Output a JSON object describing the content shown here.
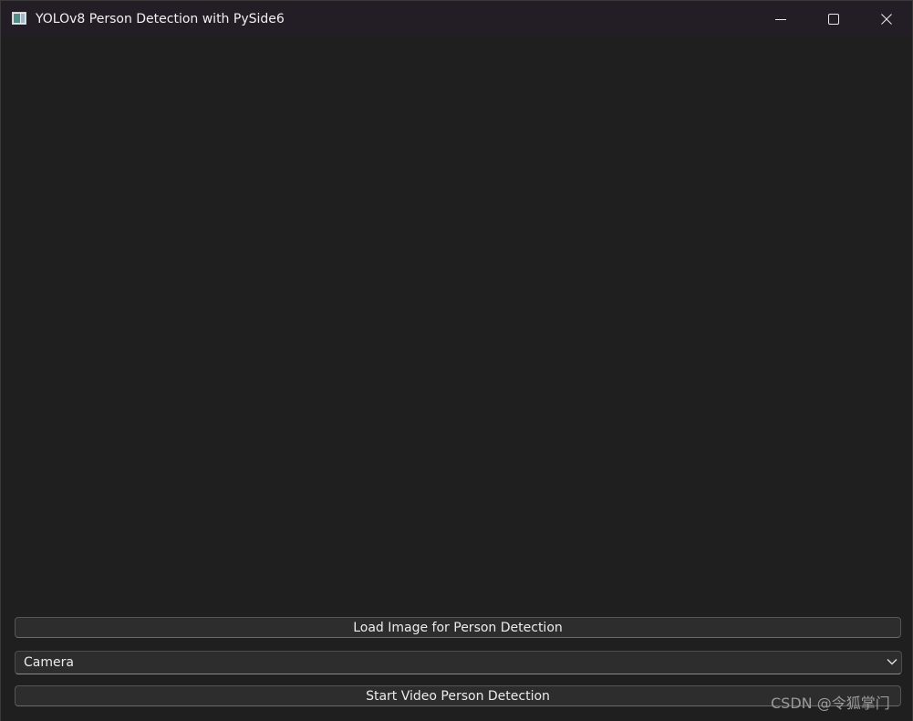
{
  "window": {
    "title": "YOLOv8 Person Detection with PySide6",
    "icons": {
      "app": "app-window-icon",
      "minimize": "minimize-icon",
      "maximize": "maximize-icon",
      "close": "close-icon"
    }
  },
  "main": {
    "load_image_button": "Load Image for Person Detection",
    "source_select": {
      "selected": "Camera",
      "icon": "chevron-down-icon"
    },
    "start_video_button": "Start Video Person Detection"
  },
  "watermark": "CSDN @令狐掌门",
  "colors": {
    "titlebar": "#231d25",
    "background": "#1f1f1f",
    "button": "#2d2d2d",
    "text": "#ececec"
  }
}
